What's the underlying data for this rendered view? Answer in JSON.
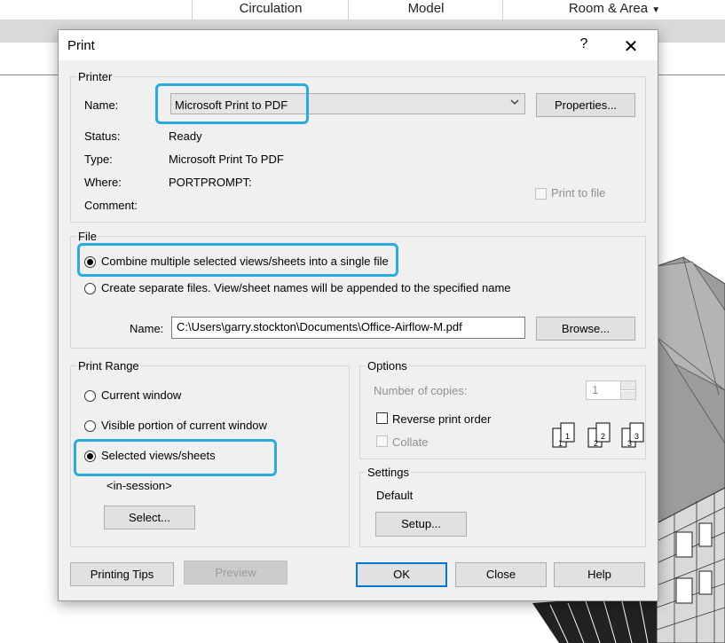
{
  "app": {
    "ribbon_tabs": [
      "Circulation",
      "Model",
      "Room & Area"
    ]
  },
  "dialog": {
    "title": "Print",
    "help_label": "?",
    "close_label": "✕",
    "printer": {
      "legend": "Printer",
      "name_label": "Name:",
      "name_value": "Microsoft Print to PDF",
      "properties_label": "Properties...",
      "status_label": "Status:",
      "status_value": "Ready",
      "type_label": "Type:",
      "type_value": "Microsoft Print To PDF",
      "where_label": "Where:",
      "where_value": "PORTPROMPT:",
      "comment_label": "Comment:",
      "print_to_file_label": "Print to file"
    },
    "file": {
      "legend": "File",
      "combine_label": "Combine multiple selected views/sheets into a single file",
      "separate_label": "Create separate files. View/sheet names will be appended to the specified name",
      "name_label": "Name:",
      "name_value": "C:\\Users\\garry.stockton\\Documents\\Office-Airflow-M.pdf",
      "browse_label": "Browse..."
    },
    "print_range": {
      "legend": "Print Range",
      "current_window_label": "Current window",
      "visible_portion_label": "Visible portion of current window",
      "selected_label": "Selected views/sheets",
      "session_label": "<in-session>",
      "select_button_label": "Select..."
    },
    "options": {
      "legend": "Options",
      "copies_label": "Number of copies:",
      "copies_value": "1",
      "reverse_label": "Reverse print order",
      "collate_label": "Collate"
    },
    "settings": {
      "legend": "Settings",
      "value": "Default",
      "setup_label": "Setup..."
    },
    "buttons": {
      "printing_tips": "Printing Tips",
      "preview": "Preview",
      "ok": "OK",
      "close": "Close",
      "help": "Help"
    }
  },
  "colors": {
    "highlight": "#29abe2",
    "dialog_bg": "#f0f0f0",
    "default_button_border": "#0078d7"
  }
}
